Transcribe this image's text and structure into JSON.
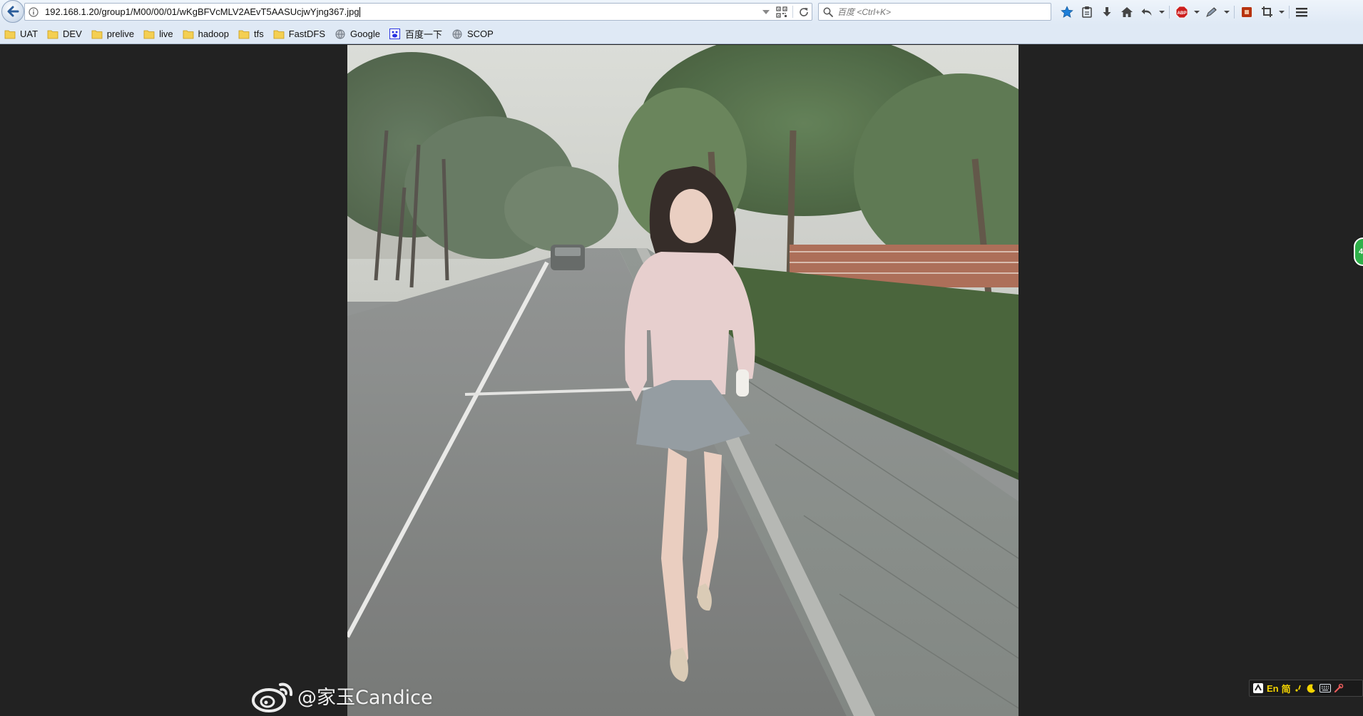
{
  "browser": {
    "url": "192.168.1.20/group1/M00/00/01/wKgBFVcMLV2AEvT5AASUcjwYjng367.jpg",
    "search": {
      "placeholder": "百度 <Ctrl+K>"
    },
    "bookmarks": [
      {
        "label": "UAT",
        "icon": "folder-icon"
      },
      {
        "label": "DEV",
        "icon": "folder-icon"
      },
      {
        "label": "prelive",
        "icon": "folder-icon"
      },
      {
        "label": "live",
        "icon": "folder-icon"
      },
      {
        "label": "hadoop",
        "icon": "folder-icon"
      },
      {
        "label": "tfs",
        "icon": "folder-icon"
      },
      {
        "label": "FastDFS",
        "icon": "folder-icon"
      },
      {
        "label": "Google",
        "icon": "globe-icon"
      },
      {
        "label": "百度一下",
        "icon": "baidu-icon"
      },
      {
        "label": "SCOP",
        "icon": "globe-icon"
      }
    ],
    "toolbar_icons": [
      "star-icon",
      "clipboard-icon",
      "download-icon",
      "home-icon",
      "undo-icon",
      "abp-icon",
      "pen-icon",
      "stop-icon",
      "crop-icon",
      "menu-icon"
    ],
    "colors": {
      "accent": "#1e7fd9",
      "abp": "#cc1f1f",
      "stop": "#b7330f"
    }
  },
  "content": {
    "watermark": "@家玉Candice",
    "side_badge": "4",
    "ime": {
      "lang": "En",
      "simplified": "简"
    }
  }
}
